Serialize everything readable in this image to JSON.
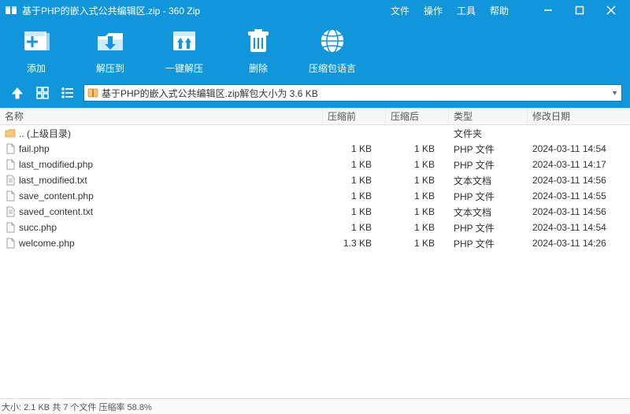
{
  "window": {
    "title": "基于PHP的嵌入式公共编辑区.zip - 360 Zip"
  },
  "menu": {
    "file": "文件",
    "operate": "操作",
    "tools": "工具",
    "help": "帮助"
  },
  "toolbar": {
    "add": "添加",
    "extract_to": "解压到",
    "one_click": "一键解压",
    "delete": "删除",
    "language": "压缩包语言"
  },
  "path": {
    "text": "基于PHP的嵌入式公共编辑区.zip解包大小为 3.6 KB"
  },
  "columns": {
    "name": "名称",
    "before": "压缩前",
    "after": "压缩后",
    "type": "类型",
    "date": "修改日期"
  },
  "rows": [
    {
      "name": ".. (上级目录)",
      "before": "",
      "after": "",
      "type": "文件夹",
      "date": "",
      "icon": "folder-up"
    },
    {
      "name": "fail.php",
      "before": "1 KB",
      "after": "1 KB",
      "type": "PHP 文件",
      "date": "2024-03-11 14:54",
      "icon": "file"
    },
    {
      "name": "last_modified.php",
      "before": "1 KB",
      "after": "1 KB",
      "type": "PHP 文件",
      "date": "2024-03-11 14:17",
      "icon": "file"
    },
    {
      "name": "last_modified.txt",
      "before": "1 KB",
      "after": "1 KB",
      "type": "文本文档",
      "date": "2024-03-11 14:56",
      "icon": "text"
    },
    {
      "name": "save_content.php",
      "before": "1 KB",
      "after": "1 KB",
      "type": "PHP 文件",
      "date": "2024-03-11 14:55",
      "icon": "file"
    },
    {
      "name": "saved_content.txt",
      "before": "1 KB",
      "after": "1 KB",
      "type": "文本文档",
      "date": "2024-03-11 14:56",
      "icon": "text"
    },
    {
      "name": "succ.php",
      "before": "1 KB",
      "after": "1 KB",
      "type": "PHP 文件",
      "date": "2024-03-11 14:54",
      "icon": "file"
    },
    {
      "name": "welcome.php",
      "before": "1.3 KB",
      "after": "1 KB",
      "type": "PHP 文件",
      "date": "2024-03-11 14:26",
      "icon": "file"
    }
  ],
  "status": {
    "text": "大小: 2.1 KB 共 7 个文件 压缩率 58.8%"
  }
}
